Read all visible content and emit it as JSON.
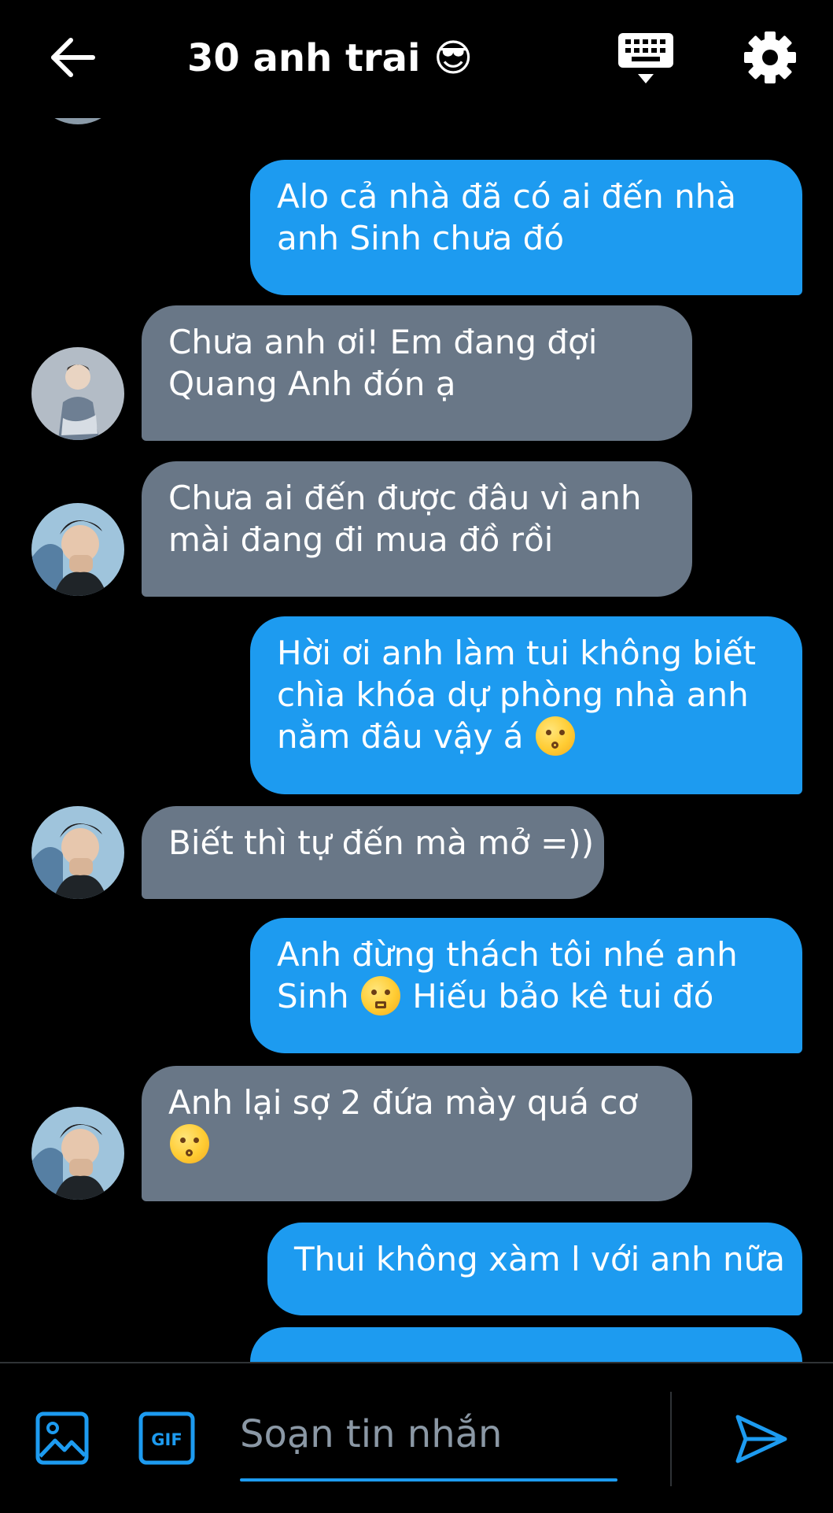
{
  "header": {
    "title": "30 anh trai 😎"
  },
  "messages": [
    {
      "direction": "out",
      "lines": [
        "Alo cả nhà đã có ai đến nhà",
        "anh Sinh chưa đó"
      ]
    },
    {
      "direction": "in",
      "avatar": "avatar-1",
      "lines": [
        "Chưa anh ơi! Em đang đợi",
        "Quang Anh đón ạ"
      ]
    },
    {
      "direction": "in",
      "avatar": "avatar-2",
      "lines": [
        "Chưa ai đến được đâu vì anh",
        "mài đang đi mua đồ rồi"
      ]
    },
    {
      "direction": "out",
      "lines": [
        "Hời ơi anh làm tui không biết",
        "chìa khóa dự phòng nhà anh",
        "nằm đâu vậy á"
      ]
    },
    {
      "direction": "in",
      "avatar": "avatar-2",
      "lines": [
        "Biết thì tự đến mà mở =))"
      ]
    },
    {
      "direction": "out",
      "lines": [
        "Anh đừng thách tôi nhé anh",
        "Sinh",
        "Hiếu bảo kê tui đó"
      ]
    },
    {
      "direction": "in",
      "avatar": "avatar-2",
      "lines": [
        "Anh lại sợ 2 đứa mày quá cơ"
      ]
    },
    {
      "direction": "out",
      "lines": [
        "Thui không xàm l với anh nữa"
      ]
    }
  ],
  "composer": {
    "placeholder": "Soạn tin nhắn",
    "gif_label": "GIF"
  },
  "icons": {
    "back": "back-arrow-icon",
    "keyboard": "keyboard-icon",
    "settings": "gear-icon",
    "image": "image-icon",
    "gif": "gif-icon",
    "send": "send-icon",
    "emoji_kiss": "kissing-face-emoji",
    "emoji_triumph": "triumph-face-emoji"
  },
  "colors": {
    "accent": "#1d9bf0",
    "incoming_bubble": "#697787",
    "background": "#000000"
  }
}
